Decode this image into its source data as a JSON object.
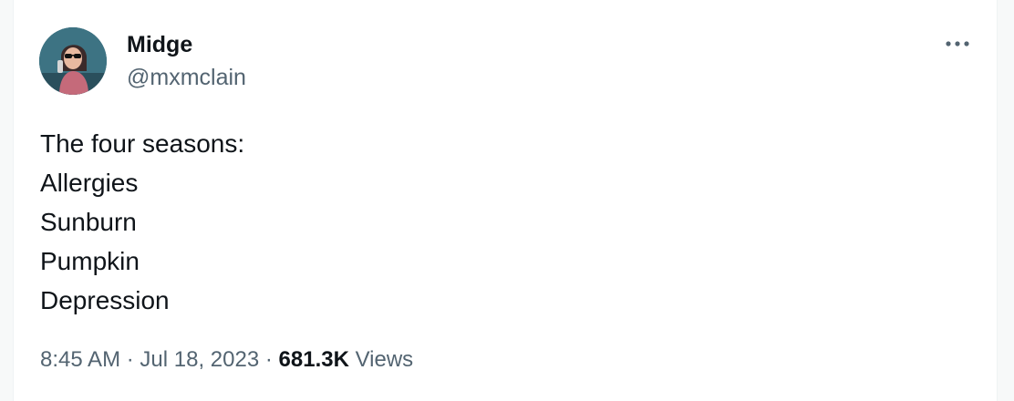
{
  "tweet": {
    "author": {
      "display_name": "Midge",
      "handle": "@mxmclain",
      "avatar_icon": "avatar-photo-icon"
    },
    "more_icon": "more-options-icon",
    "text_lines": [
      "The four seasons:",
      "Allergies",
      "Sunburn",
      "Pumpkin",
      "Depression"
    ],
    "time": "8:45 AM",
    "separator": "·",
    "date": "Jul 18, 2023",
    "views_count": "681.3K",
    "views_label": "Views"
  },
  "colors": {
    "text_primary": "#0f1419",
    "text_secondary": "#536471",
    "background": "#ffffff",
    "page_background": "#f7f9f9"
  }
}
